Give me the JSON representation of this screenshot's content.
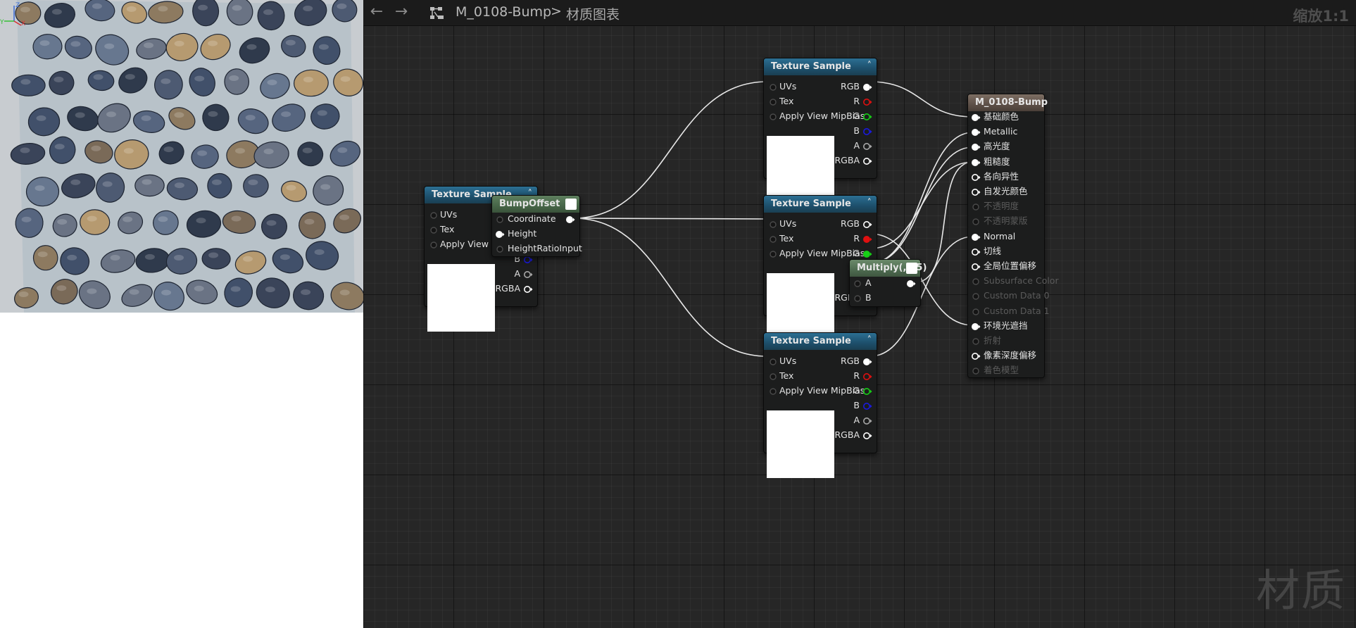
{
  "toolbar": {
    "back_icon": "arrow-left-icon",
    "forward_icon": "arrow-right-icon",
    "asset_name": "M_0108-Bump",
    "separator": ">",
    "graph_name": "材质图表",
    "zoom": "缩放1:1"
  },
  "watermark": "材质",
  "preview": {
    "axis": {
      "z": "Z",
      "y": "Y",
      "x": "X"
    }
  },
  "texture_node": {
    "title": "Texture Sample",
    "inputs": [
      "UVs",
      "Tex",
      "Apply View MipBias"
    ],
    "outputs": [
      "RGB",
      "R",
      "G",
      "B",
      "A",
      "RGBA"
    ]
  },
  "bump_node": {
    "title": "BumpOffset",
    "inputs": [
      "Coordinate",
      "Height",
      "HeightRatioInput"
    ]
  },
  "multiply_node": {
    "title": "Multiply(,0.5)",
    "inputs": [
      "A",
      "B"
    ]
  },
  "result_node": {
    "title": "M_0108-Bump",
    "inputs": [
      {
        "label": "基础颜色",
        "enabled": true,
        "connected": true
      },
      {
        "label": "Metallic",
        "enabled": true,
        "connected": true
      },
      {
        "label": "高光度",
        "enabled": true,
        "connected": true
      },
      {
        "label": "粗糙度",
        "enabled": true,
        "connected": true
      },
      {
        "label": "各向异性",
        "enabled": true,
        "connected": false
      },
      {
        "label": "自发光颜色",
        "enabled": true,
        "connected": false
      },
      {
        "label": "不透明度",
        "enabled": false,
        "connected": false
      },
      {
        "label": "不透明蒙版",
        "enabled": false,
        "connected": false
      },
      {
        "label": "Normal",
        "enabled": true,
        "connected": true
      },
      {
        "label": "切线",
        "enabled": true,
        "connected": false
      },
      {
        "label": "全局位置偏移",
        "enabled": true,
        "connected": false
      },
      {
        "label": "Subsurface Color",
        "enabled": false,
        "connected": false
      },
      {
        "label": "Custom Data 0",
        "enabled": false,
        "connected": false
      },
      {
        "label": "Custom Data 1",
        "enabled": false,
        "connected": false
      },
      {
        "label": "环境光遮挡",
        "enabled": true,
        "connected": true
      },
      {
        "label": "折射",
        "enabled": false,
        "connected": false
      },
      {
        "label": "像素深度偏移",
        "enabled": true,
        "connected": false
      },
      {
        "label": "着色模型",
        "enabled": false,
        "connected": false
      }
    ]
  },
  "colors": {
    "graph_bg": "#262626",
    "pin_red": "#e01010",
    "pin_green": "#16d016",
    "pin_blue": "#1a1ae0",
    "pin_white": "#ffffff",
    "pin_gray": "#a7a7a7"
  }
}
